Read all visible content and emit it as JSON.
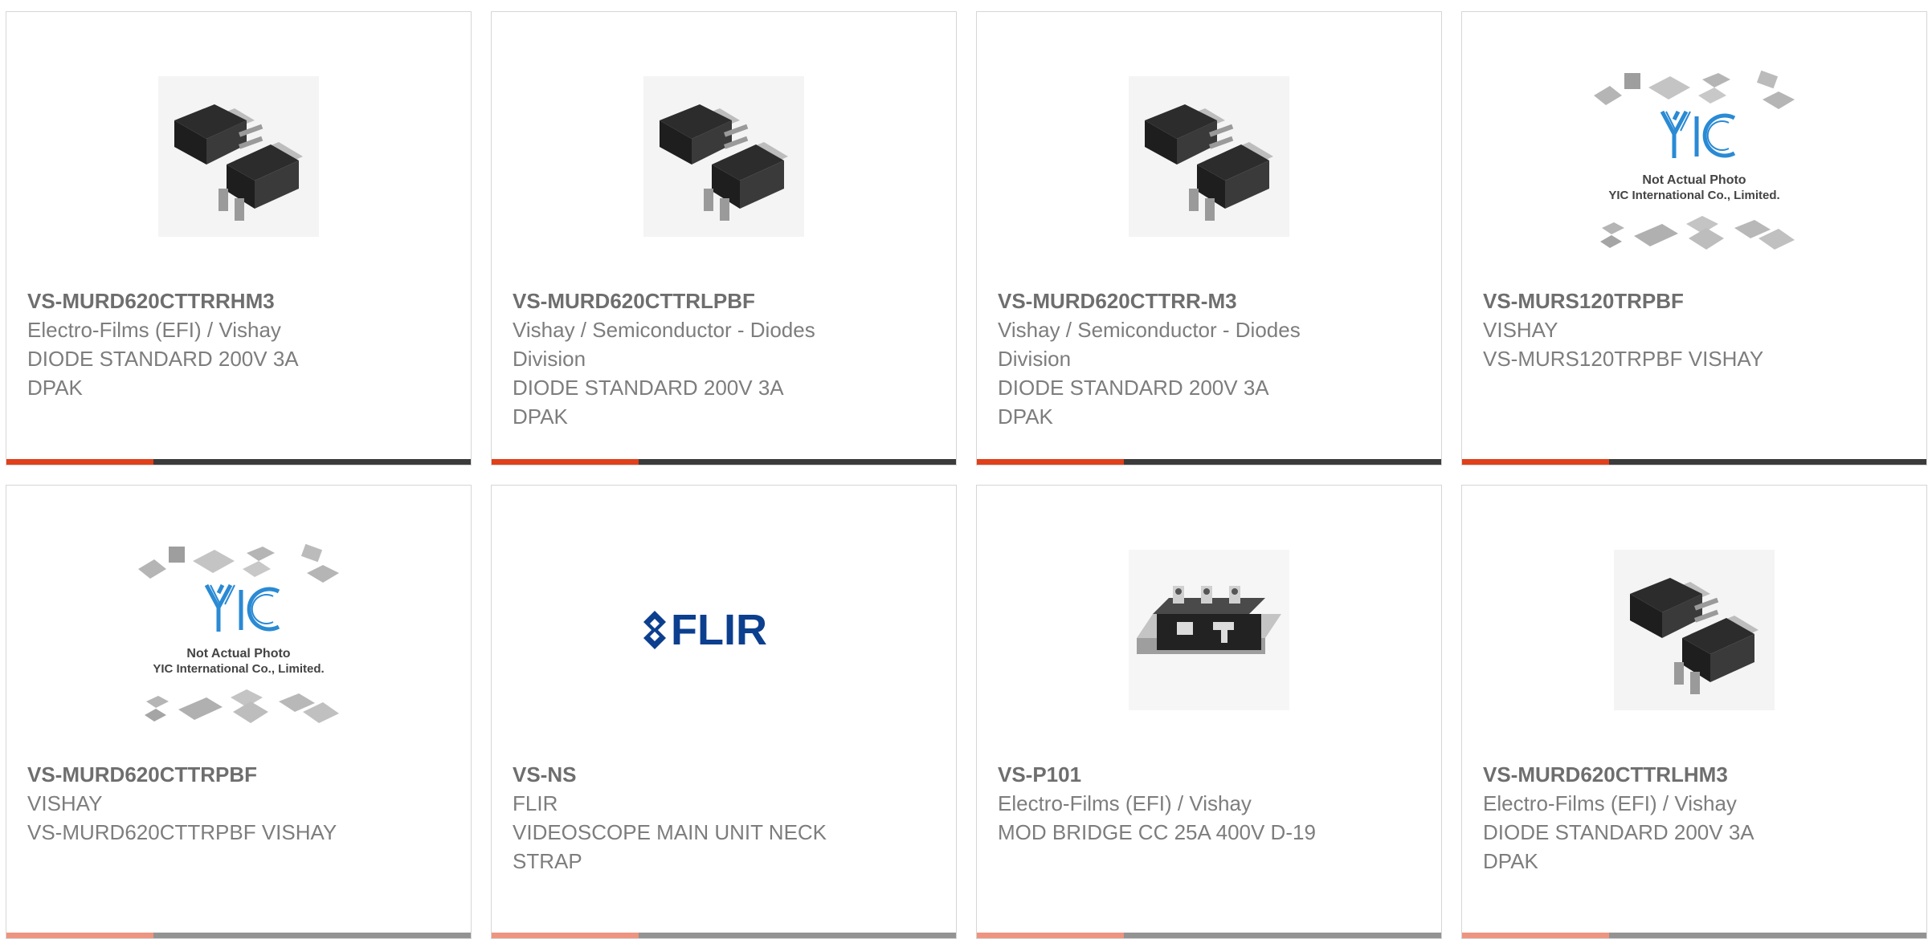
{
  "theme": {
    "accent": "#e0401a",
    "bar": "#3b3b3b",
    "text": "#7d7d7d"
  },
  "products": [
    {
      "part_number": "VS-MURD620CTTRRHM3",
      "manufacturer": "Electro-Films (EFI) / Vishay",
      "description": "DIODE STANDARD 200V 3A DPAK",
      "image": "dpak-package-icon"
    },
    {
      "part_number": "VS-MURD620CTTRLPBF",
      "manufacturer": "Vishay / Semiconductor - Diodes Division",
      "description": "DIODE STANDARD 200V 3A DPAK",
      "image": "dpak-package-icon"
    },
    {
      "part_number": "VS-MURD620CTTRR-M3",
      "manufacturer": "Vishay / Semiconductor - Diodes Division",
      "description": "DIODE STANDARD 200V 3A DPAK",
      "image": "dpak-package-icon"
    },
    {
      "part_number": "VS-MURS120TRPBF",
      "manufacturer": "VISHAY",
      "description": "VS-MURS120TRPBF VISHAY",
      "image": "yic-placeholder-icon",
      "placeholder_caption_1": "Not Actual Photo",
      "placeholder_caption_2": "YIC International Co., Limited."
    },
    {
      "part_number": "VS-MURD620CTTRPBF",
      "manufacturer": "VISHAY",
      "description": "VS-MURD620CTTRPBF VISHAY",
      "image": "yic-placeholder-icon",
      "placeholder_caption_1": "Not Actual Photo",
      "placeholder_caption_2": "YIC International Co., Limited."
    },
    {
      "part_number": "VS-NS",
      "manufacturer": "FLIR",
      "description": "VIDEOSCOPE MAIN UNIT NECK STRAP",
      "image": "flir-logo-icon",
      "logo_text": "FLIR"
    },
    {
      "part_number": "VS-P101",
      "manufacturer": "Electro-Films (EFI) / Vishay",
      "description": "MOD BRIDGE CC 25A 400V D-19",
      "image": "bridge-module-icon"
    },
    {
      "part_number": "VS-MURD620CTTRLHM3",
      "manufacturer": "Electro-Films (EFI) / Vishay",
      "description": "DIODE STANDARD 200V 3A DPAK",
      "image": "dpak-package-icon"
    }
  ]
}
